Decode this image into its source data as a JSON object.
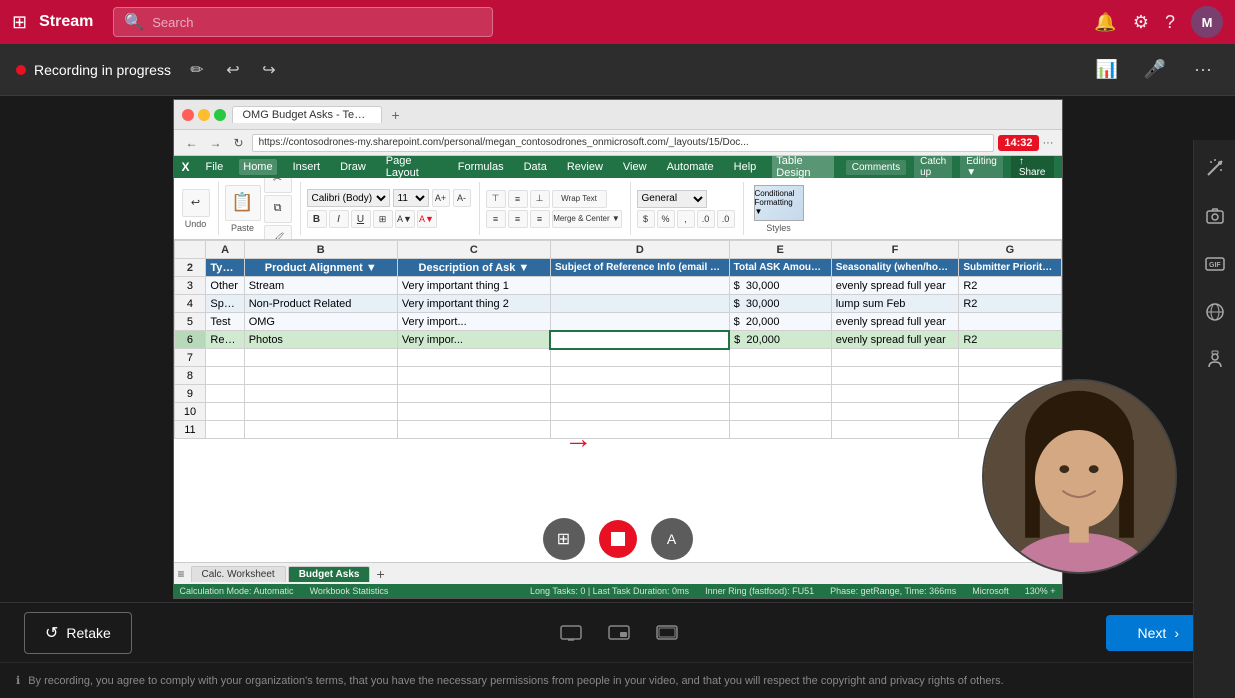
{
  "app": {
    "title": "Stream",
    "search_placeholder": "Search"
  },
  "recording": {
    "status_text": "Recording in progress",
    "timer": "14:32"
  },
  "browser": {
    "tab_title": "OMG Budget Asks - Template...",
    "url": "https://contosodrones-my.sharepoint.com/personal/megan_contosodrones_onmicrosoft.com/_layouts/15/Doc..."
  },
  "excel": {
    "ribbon_tabs": [
      "Home",
      "Insert",
      "Draw",
      "Page Layout",
      "Formulas",
      "Data",
      "Review",
      "View",
      "Automate",
      "Help",
      "Table Design"
    ],
    "active_tab": "Table Design",
    "sheet_tabs": [
      "Calc. Worksheet",
      "Budget Asks"
    ],
    "active_sheet": "Budget Asks",
    "columns": [
      "Type of Spend",
      "Product Alignment",
      "Description of Ask",
      "Subject of Reference Info (email or other...)",
      "Total ASK Amount",
      "Seasonality (when/how long)",
      "Submitter Priority"
    ],
    "rows": [
      [
        "Other",
        "Stream",
        "Very important thing 1",
        "",
        "$ 30,000",
        "evenly spread full year",
        "R2"
      ],
      [
        "Special Programs",
        "Non-Product Related",
        "Very important thing 2",
        "",
        "$ 30,000",
        "lump sum Feb",
        "R2"
      ],
      [
        "Test",
        "OMG",
        "Very import...",
        "",
        "$ 20,000",
        "evenly spread full year",
        ""
      ],
      [
        "Research",
        "Photos",
        "Very impor...",
        "",
        "$ 20,000",
        "evenly spread full year",
        "R2"
      ]
    ],
    "comments_btn": "Comments",
    "catch_up_btn": "Catch up",
    "editing_btn": "Editing",
    "share_btn": "Share"
  },
  "controls": {
    "retake_label": "Retake",
    "next_label": "Next"
  },
  "footer": {
    "disclaimer": "By recording, you agree to comply with your organization's terms, that you have the necessary permissions from people in your video, and that you will respect the copyright and privacy rights of others."
  },
  "side_panel": {
    "icons": [
      "wand",
      "camera",
      "gif",
      "globe",
      "person-badge"
    ]
  }
}
